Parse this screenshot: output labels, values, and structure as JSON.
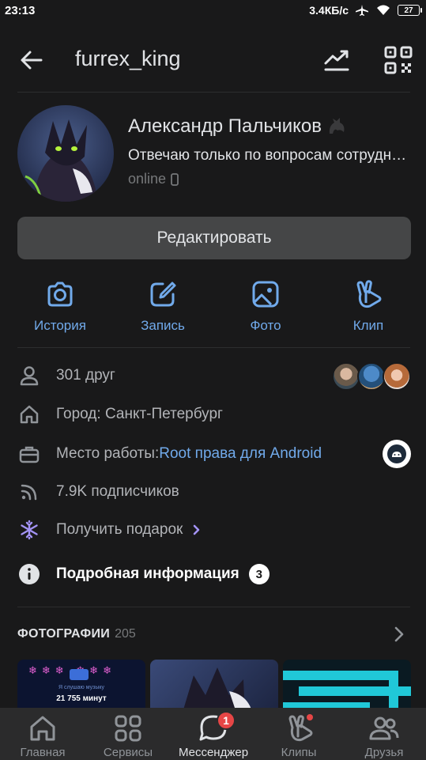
{
  "statusbar": {
    "time": "23:13",
    "speed": "3.4КБ/с",
    "battery": "27"
  },
  "header": {
    "username": "furrex_king"
  },
  "profile": {
    "name": "Александр Пальчиков",
    "status": "Отвечаю только по вопросам сотрудничества",
    "online": "online"
  },
  "edit_button": "Редактировать",
  "actions": [
    {
      "label": "История",
      "icon": "camera-icon"
    },
    {
      "label": "Запись",
      "icon": "edit-icon"
    },
    {
      "label": "Фото",
      "icon": "image-icon"
    },
    {
      "label": "Клип",
      "icon": "clip-icon"
    }
  ],
  "info": {
    "friends": "301 друг",
    "city": "Город: Санкт-Петербург",
    "work_label": "Место работы: ",
    "work_link": "Root права для Android",
    "followers": "7.9K подписчиков",
    "gift": "Получить подарок",
    "details": "Подробная информация",
    "details_count": "3"
  },
  "photos": {
    "title": "ФОТОГРАФИИ",
    "count": "205",
    "thumb1_text_a": "Я слушаю музыку",
    "thumb1_text_b": "21 755 минут"
  },
  "tabs": [
    {
      "label": "Главная",
      "icon": "home-icon"
    },
    {
      "label": "Сервисы",
      "icon": "services-icon"
    },
    {
      "label": "Мессенджер",
      "icon": "messenger-icon",
      "badge": "1"
    },
    {
      "label": "Клипы",
      "icon": "clips-icon"
    },
    {
      "label": "Друзья",
      "icon": "friends-icon"
    }
  ],
  "colors": {
    "background": "#19191a",
    "accent": "#71aaeb",
    "gift": "#a393f5",
    "button": "#454647",
    "badge": "#e64646"
  }
}
